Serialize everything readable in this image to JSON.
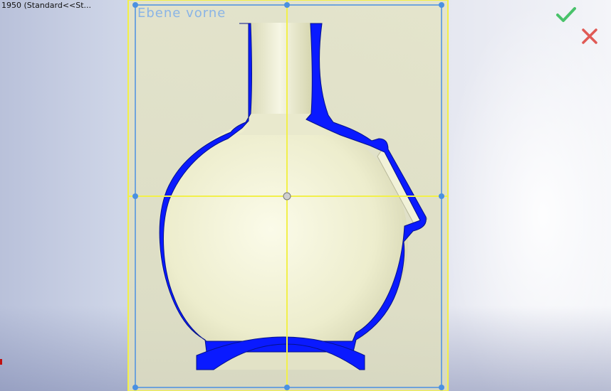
{
  "tree": {
    "title": "1950  (Standard<<St..."
  },
  "view": {
    "plane_label": "Ebene vorne"
  },
  "icons": {
    "ok": "checkmark-icon",
    "cancel": "close-icon"
  },
  "colors": {
    "section_fill": "#0a1aff",
    "plane_border": "#f2f04a",
    "handle": "#4a90e2",
    "confirm": "#49c26a",
    "cancel": "#e05a55",
    "part_face": "#efefcf"
  }
}
